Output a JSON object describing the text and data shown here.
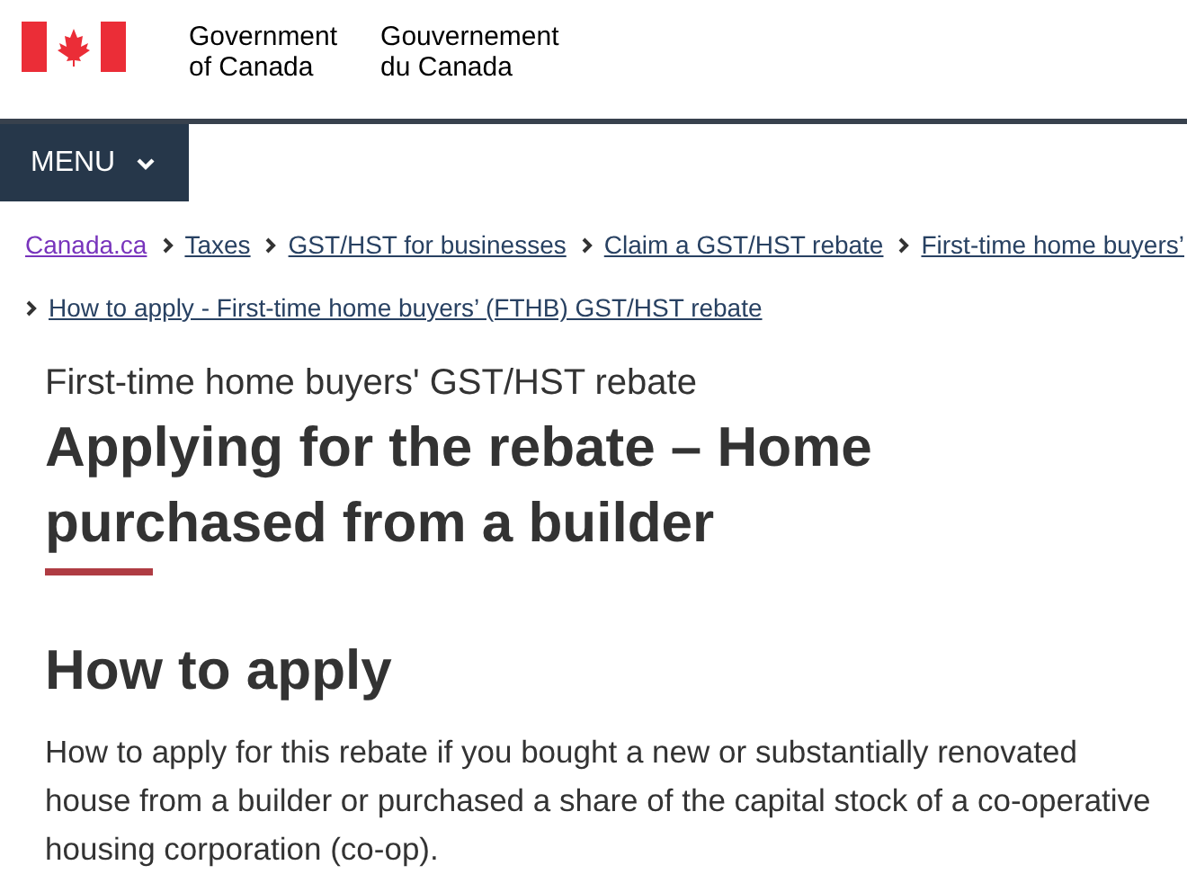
{
  "header": {
    "name_en": [
      "Government",
      "of Canada"
    ],
    "name_fr": [
      "Gouvernement",
      "du Canada"
    ]
  },
  "menu": {
    "label": "MENU",
    "expanded": false
  },
  "breadcrumbs": [
    {
      "label": "Canada.ca",
      "visited": true
    },
    {
      "label": "Taxes",
      "visited": false
    },
    {
      "label": "GST/HST for businesses",
      "visited": false
    },
    {
      "label": "Claim a GST/HST rebate",
      "visited": false
    },
    {
      "label": "First-time home buyers’",
      "visited": false
    },
    {
      "label": "How to apply - First-time home buyers’ (FTHB) GST/HST rebate",
      "visited": false
    }
  ],
  "page": {
    "subtitle": "First-time home buyers' GST/HST rebate",
    "title": "Applying for the rebate – Home purchased from a builder",
    "section_heading": "How to apply",
    "paragraph": "How to apply for this rebate if you bought a new or substantially renovated house from a builder or purchased a share of the capital stock of a co-operative housing corporation (co-op)."
  }
}
